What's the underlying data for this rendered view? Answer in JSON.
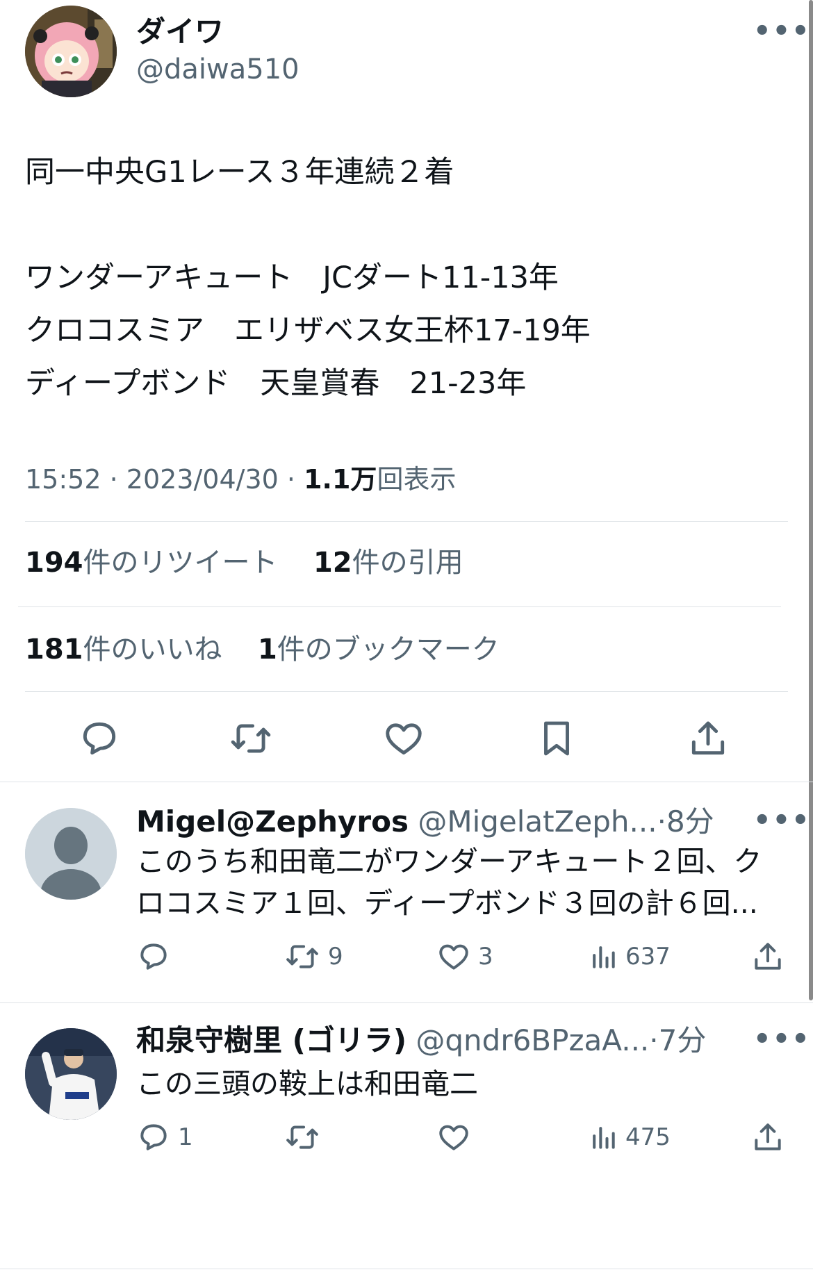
{
  "tweet": {
    "author_name": "ダイワ",
    "author_handle": "@daiwa510",
    "lines": [
      "同一中央G1レース３年連続２着",
      "",
      "ワンダーアキュート　JCダート11-13年",
      "クロコスミア　エリザベス女王杯17-19年",
      "ディープボンド　天皇賞春　21-23年"
    ],
    "time": "15:52",
    "date": "2023/04/30",
    "views_count": "1.1万",
    "views_label": "回表示",
    "retweets_count": "194",
    "retweets_label": "件のリツイート",
    "quotes_count": "12",
    "quotes_label": "件の引用",
    "likes_count": "181",
    "likes_label": "件のいいね",
    "bookmarks_count": "1",
    "bookmarks_label": "件のブックマーク"
  },
  "replies": [
    {
      "name": "Migel@Zephyros",
      "handle": "@MigelatZeph...",
      "time": "8分",
      "text_lines": [
        "このうち和田竜二がワンダーアキュート２回、ク",
        "ロコスミア１回、ディープボンド３回の計６回..."
      ],
      "reply_count": "",
      "retweet_count": "9",
      "like_count": "3",
      "view_count": "637"
    },
    {
      "name": "和泉守樹里 (ゴリラ)",
      "handle": "@qndr6BPzaA...",
      "time": "7分",
      "text_lines": [
        "この三頭の鞍上は和田竜二"
      ],
      "reply_count": "1",
      "retweet_count": "",
      "like_count": "",
      "view_count": "475"
    }
  ],
  "ui": {
    "separator": "·",
    "more": "•••"
  },
  "colors": {
    "text": "#0f1419",
    "secondary": "#536471",
    "divider": "#dfe3e7"
  }
}
